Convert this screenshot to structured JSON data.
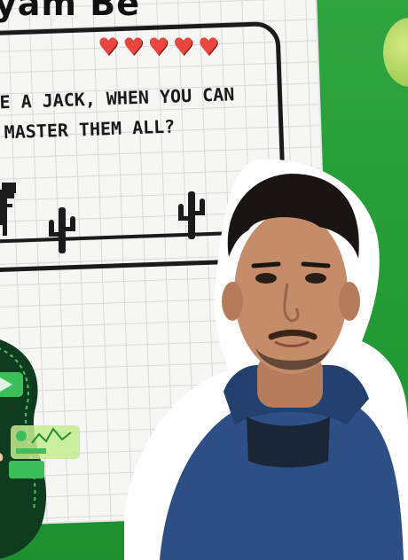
{
  "title": "yam Be",
  "quote": {
    "line1": "E A JACK, WHEN YOU CAN",
    "line2": "MASTER THEM ALL?"
  },
  "hearts": [
    "♥",
    "♥",
    "♥",
    "♥",
    "♥"
  ],
  "colors": {
    "background": "#2e9f3c",
    "heart": "#e8463f",
    "ink": "#1b1b1b",
    "hoodie": "#2d4f86"
  },
  "icons": [
    "heart-icon",
    "dino-icon",
    "cactus-icon",
    "play-icon",
    "chart-card-icon"
  ]
}
